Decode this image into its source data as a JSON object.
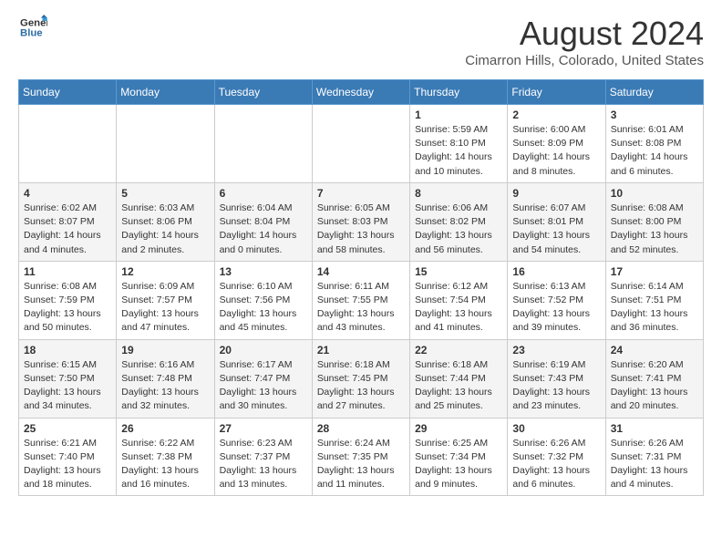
{
  "logo": {
    "line1": "General",
    "line2": "Blue"
  },
  "title": "August 2024",
  "subtitle": "Cimarron Hills, Colorado, United States",
  "weekdays": [
    "Sunday",
    "Monday",
    "Tuesday",
    "Wednesday",
    "Thursday",
    "Friday",
    "Saturday"
  ],
  "weeks": [
    [
      {
        "day": "",
        "info": ""
      },
      {
        "day": "",
        "info": ""
      },
      {
        "day": "",
        "info": ""
      },
      {
        "day": "",
        "info": ""
      },
      {
        "day": "1",
        "info": "Sunrise: 5:59 AM\nSunset: 8:10 PM\nDaylight: 14 hours\nand 10 minutes."
      },
      {
        "day": "2",
        "info": "Sunrise: 6:00 AM\nSunset: 8:09 PM\nDaylight: 14 hours\nand 8 minutes."
      },
      {
        "day": "3",
        "info": "Sunrise: 6:01 AM\nSunset: 8:08 PM\nDaylight: 14 hours\nand 6 minutes."
      }
    ],
    [
      {
        "day": "4",
        "info": "Sunrise: 6:02 AM\nSunset: 8:07 PM\nDaylight: 14 hours\nand 4 minutes."
      },
      {
        "day": "5",
        "info": "Sunrise: 6:03 AM\nSunset: 8:06 PM\nDaylight: 14 hours\nand 2 minutes."
      },
      {
        "day": "6",
        "info": "Sunrise: 6:04 AM\nSunset: 8:04 PM\nDaylight: 14 hours\nand 0 minutes."
      },
      {
        "day": "7",
        "info": "Sunrise: 6:05 AM\nSunset: 8:03 PM\nDaylight: 13 hours\nand 58 minutes."
      },
      {
        "day": "8",
        "info": "Sunrise: 6:06 AM\nSunset: 8:02 PM\nDaylight: 13 hours\nand 56 minutes."
      },
      {
        "day": "9",
        "info": "Sunrise: 6:07 AM\nSunset: 8:01 PM\nDaylight: 13 hours\nand 54 minutes."
      },
      {
        "day": "10",
        "info": "Sunrise: 6:08 AM\nSunset: 8:00 PM\nDaylight: 13 hours\nand 52 minutes."
      }
    ],
    [
      {
        "day": "11",
        "info": "Sunrise: 6:08 AM\nSunset: 7:59 PM\nDaylight: 13 hours\nand 50 minutes."
      },
      {
        "day": "12",
        "info": "Sunrise: 6:09 AM\nSunset: 7:57 PM\nDaylight: 13 hours\nand 47 minutes."
      },
      {
        "day": "13",
        "info": "Sunrise: 6:10 AM\nSunset: 7:56 PM\nDaylight: 13 hours\nand 45 minutes."
      },
      {
        "day": "14",
        "info": "Sunrise: 6:11 AM\nSunset: 7:55 PM\nDaylight: 13 hours\nand 43 minutes."
      },
      {
        "day": "15",
        "info": "Sunrise: 6:12 AM\nSunset: 7:54 PM\nDaylight: 13 hours\nand 41 minutes."
      },
      {
        "day": "16",
        "info": "Sunrise: 6:13 AM\nSunset: 7:52 PM\nDaylight: 13 hours\nand 39 minutes."
      },
      {
        "day": "17",
        "info": "Sunrise: 6:14 AM\nSunset: 7:51 PM\nDaylight: 13 hours\nand 36 minutes."
      }
    ],
    [
      {
        "day": "18",
        "info": "Sunrise: 6:15 AM\nSunset: 7:50 PM\nDaylight: 13 hours\nand 34 minutes."
      },
      {
        "day": "19",
        "info": "Sunrise: 6:16 AM\nSunset: 7:48 PM\nDaylight: 13 hours\nand 32 minutes."
      },
      {
        "day": "20",
        "info": "Sunrise: 6:17 AM\nSunset: 7:47 PM\nDaylight: 13 hours\nand 30 minutes."
      },
      {
        "day": "21",
        "info": "Sunrise: 6:18 AM\nSunset: 7:45 PM\nDaylight: 13 hours\nand 27 minutes."
      },
      {
        "day": "22",
        "info": "Sunrise: 6:18 AM\nSunset: 7:44 PM\nDaylight: 13 hours\nand 25 minutes."
      },
      {
        "day": "23",
        "info": "Sunrise: 6:19 AM\nSunset: 7:43 PM\nDaylight: 13 hours\nand 23 minutes."
      },
      {
        "day": "24",
        "info": "Sunrise: 6:20 AM\nSunset: 7:41 PM\nDaylight: 13 hours\nand 20 minutes."
      }
    ],
    [
      {
        "day": "25",
        "info": "Sunrise: 6:21 AM\nSunset: 7:40 PM\nDaylight: 13 hours\nand 18 minutes."
      },
      {
        "day": "26",
        "info": "Sunrise: 6:22 AM\nSunset: 7:38 PM\nDaylight: 13 hours\nand 16 minutes."
      },
      {
        "day": "27",
        "info": "Sunrise: 6:23 AM\nSunset: 7:37 PM\nDaylight: 13 hours\nand 13 minutes."
      },
      {
        "day": "28",
        "info": "Sunrise: 6:24 AM\nSunset: 7:35 PM\nDaylight: 13 hours\nand 11 minutes."
      },
      {
        "day": "29",
        "info": "Sunrise: 6:25 AM\nSunset: 7:34 PM\nDaylight: 13 hours\nand 9 minutes."
      },
      {
        "day": "30",
        "info": "Sunrise: 6:26 AM\nSunset: 7:32 PM\nDaylight: 13 hours\nand 6 minutes."
      },
      {
        "day": "31",
        "info": "Sunrise: 6:26 AM\nSunset: 7:31 PM\nDaylight: 13 hours\nand 4 minutes."
      }
    ]
  ],
  "accent_color": "#3a7ab5"
}
